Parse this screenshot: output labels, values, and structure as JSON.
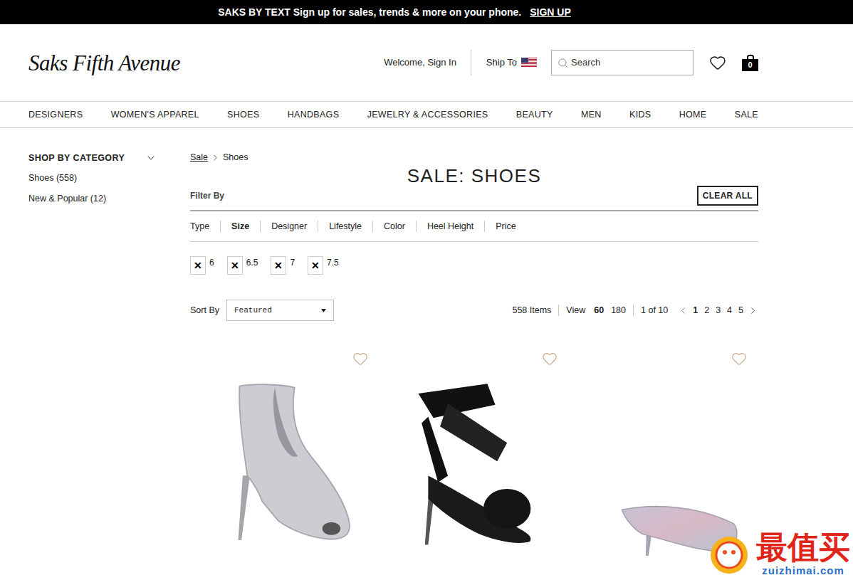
{
  "promo_bar": {
    "text": "SAKS BY TEXT Sign up for sales, trends & more on your phone.",
    "link": "SIGN UP"
  },
  "header": {
    "logo": "Saks Fifth Avenue",
    "sign_in": "Welcome, Sign In",
    "ship_to": "Ship To",
    "search": {
      "placeholder": "Search"
    },
    "bag_count": "0"
  },
  "nav": [
    "DESIGNERS",
    "WOMEN'S APPAREL",
    "SHOES",
    "HANDBAGS",
    "JEWELRY & ACCESSORIES",
    "BEAUTY",
    "MEN",
    "KIDS",
    "HOME",
    "SALE"
  ],
  "sidebar": {
    "title": "SHOP BY CATEGORY",
    "expanded": true,
    "items": [
      {
        "label": "Shoes (558)"
      },
      {
        "label": "New & Popular (12)"
      }
    ]
  },
  "breadcrumb": [
    {
      "label": "Sale",
      "link": true
    },
    {
      "label": "Shoes",
      "link": false
    }
  ],
  "title": "SALE: SHOES",
  "filter": {
    "label": "Filter By",
    "clear": "CLEAR ALL",
    "tabs": [
      {
        "label": "Type",
        "selected": false
      },
      {
        "label": "Size",
        "selected": true
      },
      {
        "label": "Designer",
        "selected": false
      },
      {
        "label": "Lifestyle",
        "selected": false
      },
      {
        "label": "Color",
        "selected": false
      },
      {
        "label": "Heel Height",
        "selected": false
      },
      {
        "label": "Price",
        "selected": false
      }
    ],
    "chip_remove": "✕",
    "chips": [
      {
        "label": "6"
      },
      {
        "label": "6.5"
      },
      {
        "label": "7"
      },
      {
        "label": "7.5"
      }
    ]
  },
  "sort": {
    "label": "Sort By",
    "value": "Featured"
  },
  "pagination": {
    "count": "558 Items",
    "view_label": "View",
    "view_options": [
      {
        "label": "60",
        "selected": true
      },
      {
        "label": "180",
        "selected": false
      }
    ],
    "page_info": "1 of 10",
    "pages": [
      {
        "label": "1",
        "selected": true
      },
      {
        "label": "2",
        "selected": false
      },
      {
        "label": "3",
        "selected": false
      },
      {
        "label": "4",
        "selected": false
      },
      {
        "label": "5",
        "selected": false
      }
    ]
  },
  "products": [
    {
      "kind": "bootie",
      "favorited": false
    },
    {
      "kind": "sandal",
      "favorited": false
    },
    {
      "kind": "mule",
      "favorited": false
    }
  ],
  "watermark": {
    "brand": "最值买",
    "site": "zuizhimai.com"
  }
}
